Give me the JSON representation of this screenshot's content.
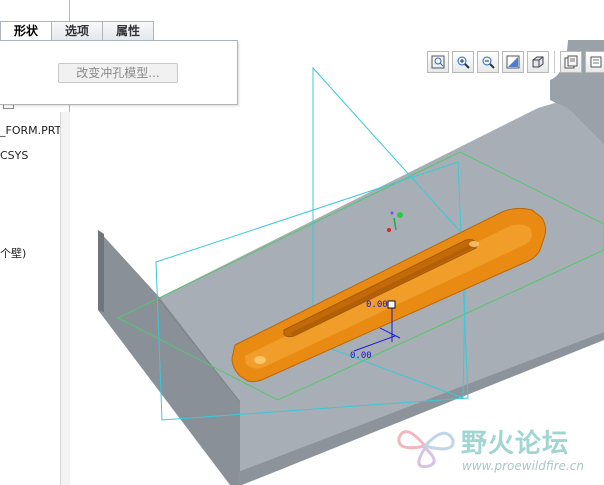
{
  "tabs": [
    "形状",
    "选项",
    "属性"
  ],
  "active_tab": "形状",
  "slideup": {
    "change_button": "改变冲孔模型..."
  },
  "model_tree": {
    "items": [
      "_FORM.PRT",
      "CSYS",
      "个壁)"
    ]
  },
  "dimensions": {
    "dim_top": "0.00",
    "dim_bottom": "0.00"
  },
  "toolbar": {
    "icons": [
      "refit-icon",
      "zoom-in-icon",
      "zoom-out-icon",
      "repaint-icon",
      "orient-icon",
      "saved-views-icon",
      "layers-icon"
    ]
  },
  "watermark": {
    "text": "野火论坛",
    "url": "www.proewildfire.cn"
  },
  "colors": {
    "punch": "#e98a12",
    "sheet_top": "#a3aab2",
    "sheet_side": "#858b94",
    "datum_plane": "#3cc8d8",
    "sketch": "#49c463"
  }
}
